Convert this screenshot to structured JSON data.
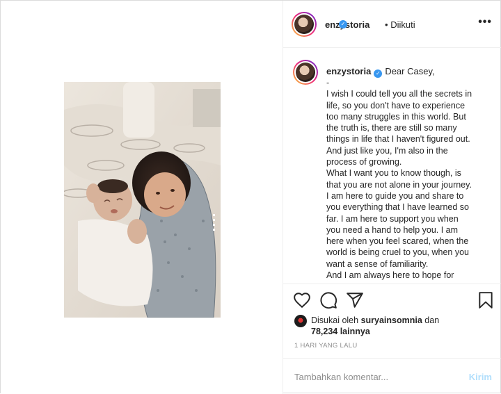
{
  "post": {
    "username": "enzystoria",
    "follow_separator": "•",
    "follow_status": "Diikuti",
    "more_icon": "•••",
    "caption_first_line": "Dear Casey,",
    "caption_lines": [
      "-",
      "I wish I could tell you all the secrets in",
      "life, so you don't have to experience",
      "too many struggles in this world. But",
      "the truth is, there are still so many",
      "things in life that I haven't figured out.",
      "And just like you, I'm also in the",
      "process of growing.",
      "What I want you to know though, is",
      "that you are not alone in your journey.",
      "I am here to guide you and share to",
      "you everything that I have learned so",
      "far. I am here to support you when",
      "you need a hand to help you. I am",
      "here when you feel scared, when the",
      "world is being cruel to you, when you",
      "want a sense of familiarity.",
      "And I am always here to hope for"
    ],
    "liked_by_prefix": "Disukai oleh",
    "liked_by_user": "suryainsomnia",
    "liked_by_conj": "dan",
    "likes_count": "78,234 lainnya",
    "timestamp": "1 HARI YANG LALU",
    "comment_placeholder": "Tambahkan komentar...",
    "post_button": "Kirim"
  },
  "icons": {
    "like": "heart-icon",
    "comment": "comment-icon",
    "share": "share-icon",
    "save": "bookmark-icon",
    "verified": "verified-badge-icon"
  },
  "colors": {
    "verified": "#3897f0",
    "post_button_disabled": "#b2dffc",
    "muted_text": "#8e8e8e"
  }
}
